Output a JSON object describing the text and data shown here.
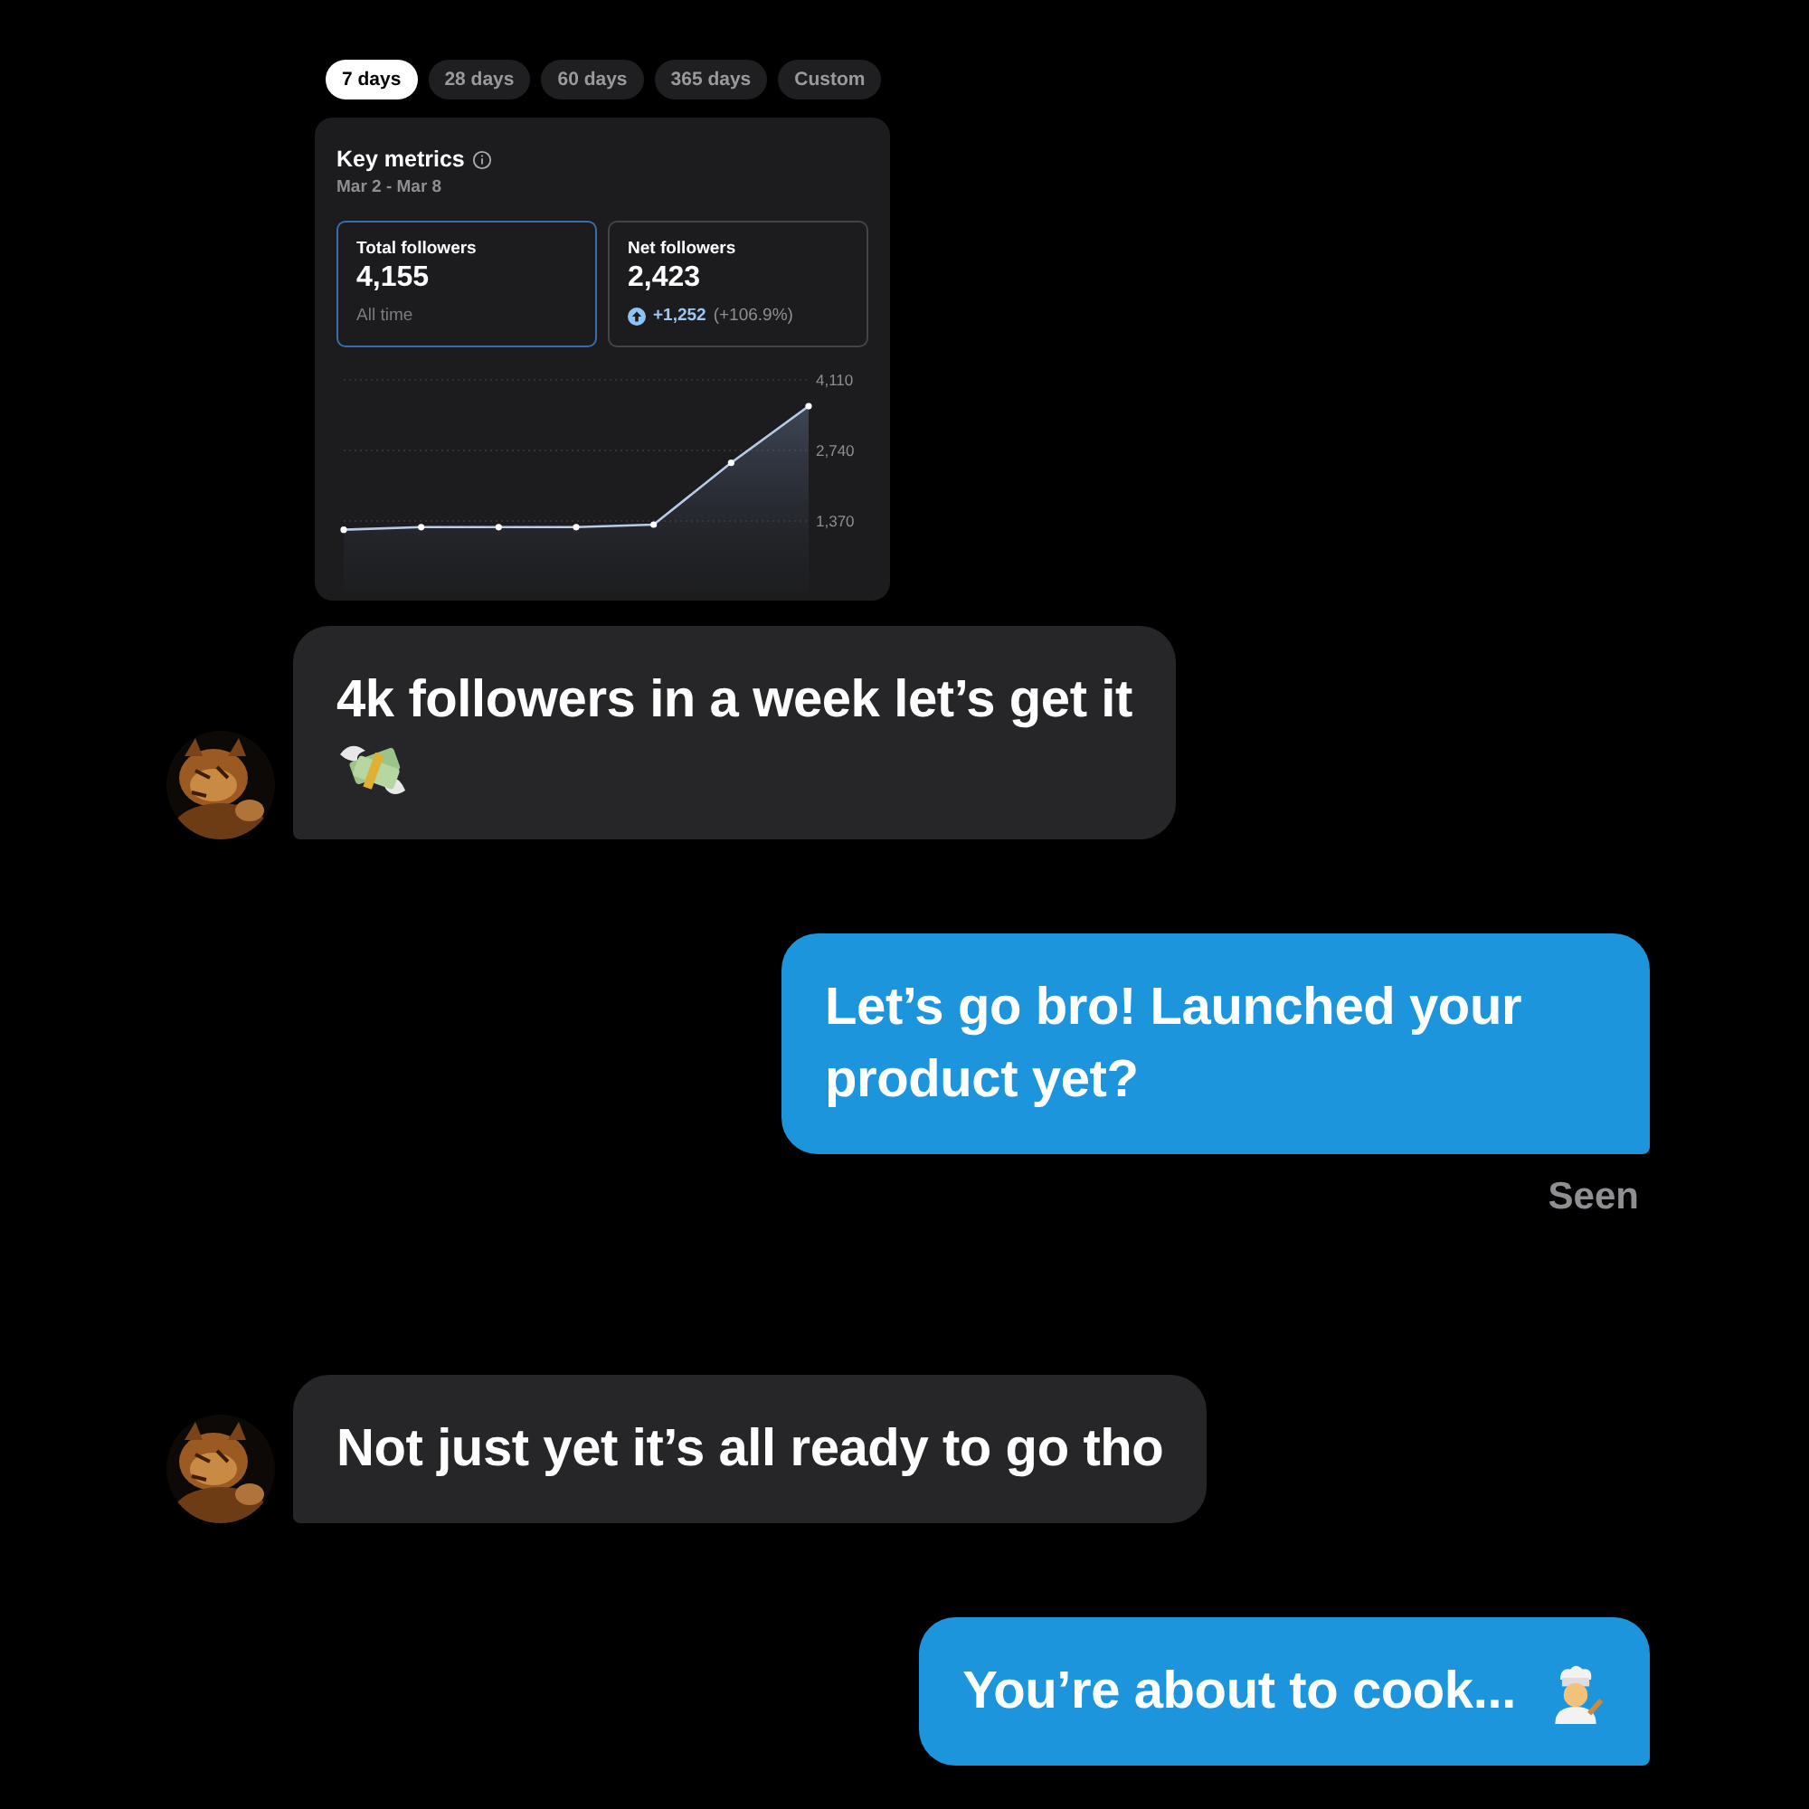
{
  "period_tabs": [
    {
      "label": "7 days",
      "selected": true
    },
    {
      "label": "28 days",
      "selected": false
    },
    {
      "label": "60 days",
      "selected": false
    },
    {
      "label": "365 days",
      "selected": false
    },
    {
      "label": "Custom",
      "selected": false
    }
  ],
  "key_metrics": {
    "title": "Key metrics",
    "date_range": "Mar 2 - Mar 8",
    "cards": [
      {
        "label": "Total followers",
        "value": "4,155",
        "note": "All time",
        "selected": true
      },
      {
        "label": "Net followers",
        "value": "2,423",
        "change": "+1,252",
        "change_pct": "(+106.9%)",
        "selected": false
      }
    ],
    "chart_data": {
      "type": "area",
      "values": [
        1200,
        1250,
        1250,
        1250,
        1300,
        2500,
        3600
      ],
      "ylim": [
        0,
        4110
      ],
      "grid": true,
      "yticks": [
        {
          "value": 1370,
          "label": "1,370"
        },
        {
          "value": 2740,
          "label": "2,740"
        },
        {
          "value": 4110,
          "label": "4,110"
        }
      ]
    }
  },
  "messages": [
    {
      "kind": "incoming",
      "text": "4k followers in a week let’s get it",
      "emoji": {
        "kind": "money"
      }
    },
    {
      "kind": "outgoing",
      "text": "Let’s go bro! Launched your product yet?",
      "receipt": "Seen"
    },
    {
      "kind": "incoming",
      "text": "Not just yet it’s all ready to go tho"
    },
    {
      "kind": "outgoing",
      "text": "You’re about to cook...",
      "emoji": {
        "kind": "cook"
      }
    }
  ]
}
